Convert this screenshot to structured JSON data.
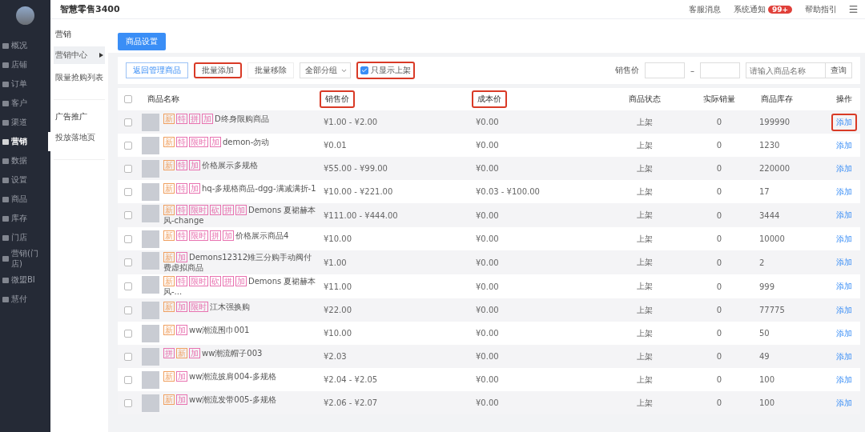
{
  "app": {
    "title": "智慧零售3400"
  },
  "topbar": {
    "links": [
      {
        "label": "客服消息"
      },
      {
        "label": "系统通知",
        "badge": "99+"
      },
      {
        "label": "帮助指引"
      }
    ]
  },
  "sidebar": {
    "items": [
      {
        "label": "概况",
        "selected": false
      },
      {
        "label": "店铺",
        "selected": false
      },
      {
        "label": "订单",
        "selected": false
      },
      {
        "label": "客户",
        "selected": false
      },
      {
        "label": "渠道",
        "selected": false
      },
      {
        "label": "营销",
        "selected": true
      },
      {
        "label": "数据",
        "selected": false
      },
      {
        "label": "设置",
        "selected": false
      },
      {
        "label": "商品",
        "selected": false
      },
      {
        "label": "库存",
        "selected": false
      },
      {
        "label": "门店",
        "selected": false
      },
      {
        "label": "营销(门店)",
        "selected": false
      },
      {
        "label": "微盟BI",
        "selected": false
      },
      {
        "label": "慧付",
        "selected": false
      }
    ]
  },
  "subnav": {
    "sections": [
      {
        "title": "营销",
        "items": [
          {
            "label": "营销中心",
            "selected": true
          },
          {
            "label": "限量抢购列表",
            "selected": false
          }
        ]
      },
      {
        "title": "广告推广",
        "items": [
          {
            "label": "投放落地页",
            "selected": false
          }
        ]
      }
    ]
  },
  "primary_button": "商品设置",
  "toolbar": {
    "buttons": [
      {
        "label": "返回管理商品",
        "kind": "outline",
        "highlighted": false
      },
      {
        "label": "批量添加",
        "kind": "plain",
        "highlighted": true
      },
      {
        "label": "批量移除",
        "kind": "plain",
        "highlighted": false
      }
    ],
    "group_select": "全部分组",
    "only_listed": {
      "label": "只显示上架",
      "checked": true,
      "highlighted": true
    },
    "price_label": "销售价",
    "price_separator": "–",
    "search": {
      "placeholder": "请输入商品名称"
    },
    "search_button": "查询"
  },
  "table": {
    "select_all_checked": false,
    "columns": [
      {
        "label": "商品名称",
        "highlighted": false
      },
      {
        "label": "销售价",
        "highlighted": true
      },
      {
        "label": "成本价",
        "highlighted": true
      },
      {
        "label": "商品状态",
        "highlighted": false
      },
      {
        "label": "实际销量",
        "highlighted": false
      },
      {
        "label": "商品库存",
        "highlighted": false
      },
      {
        "label": "操作",
        "highlighted": false
      }
    ],
    "rows": [
      {
        "tags": [
          {
            "text": "新",
            "color": "#f0a060"
          },
          {
            "text": "特",
            "color": "#e872b0"
          },
          {
            "text": "拼",
            "color": "#e872b0"
          },
          {
            "text": "加",
            "color": "#e872b0"
          }
        ],
        "name": "D终身限购商品",
        "price": "¥1.00 - ¥2.00",
        "cost": "¥0.00",
        "status": "上架",
        "sales": "0",
        "stock": "199990",
        "action": "添加",
        "action_highlighted": true,
        "checked": false
      },
      {
        "tags": [
          {
            "text": "新",
            "color": "#f0a060"
          },
          {
            "text": "特",
            "color": "#e872b0"
          },
          {
            "text": "限时",
            "color": "#e872b0"
          },
          {
            "text": "加",
            "color": "#e872b0"
          }
        ],
        "name": "demon-勿动",
        "price": "¥0.01",
        "cost": "¥0.00",
        "status": "上架",
        "sales": "0",
        "stock": "1230",
        "action": "添加",
        "action_highlighted": false,
        "checked": false
      },
      {
        "tags": [
          {
            "text": "新",
            "color": "#f0a060"
          },
          {
            "text": "特",
            "color": "#e872b0"
          },
          {
            "text": "加",
            "color": "#e872b0"
          }
        ],
        "name": "价格展示多规格",
        "price": "¥55.00 - ¥99.00",
        "cost": "¥0.00",
        "status": "上架",
        "sales": "0",
        "stock": "220000",
        "action": "添加",
        "action_highlighted": false,
        "checked": false
      },
      {
        "tags": [
          {
            "text": "新",
            "color": "#f0a060"
          },
          {
            "text": "特",
            "color": "#e872b0"
          },
          {
            "text": "加",
            "color": "#e872b0"
          }
        ],
        "name": "hq-多规格商品-dgg-满减满折-1",
        "price": "¥10.00 - ¥221.00",
        "cost": "¥0.03 - ¥100.00",
        "status": "上架",
        "sales": "0",
        "stock": "17",
        "action": "添加",
        "action_highlighted": false,
        "checked": false
      },
      {
        "tags": [
          {
            "text": "新",
            "color": "#f0a060"
          },
          {
            "text": "特",
            "color": "#e872b0"
          },
          {
            "text": "限时",
            "color": "#e872b0"
          },
          {
            "text": "砍",
            "color": "#e872b0"
          },
          {
            "text": "拼",
            "color": "#e872b0"
          },
          {
            "text": "加",
            "color": "#e872b0"
          }
        ],
        "name": "Demons 夏裙赫本风-change",
        "price": "¥111.00 - ¥444.00",
        "cost": "¥0.00",
        "status": "上架",
        "sales": "0",
        "stock": "3444",
        "action": "添加",
        "action_highlighted": false,
        "checked": false
      },
      {
        "tags": [
          {
            "text": "新",
            "color": "#f0a060"
          },
          {
            "text": "特",
            "color": "#e872b0"
          },
          {
            "text": "限时",
            "color": "#e872b0"
          },
          {
            "text": "拼",
            "color": "#e872b0"
          },
          {
            "text": "加",
            "color": "#e872b0"
          }
        ],
        "name": "价格展示商品4",
        "price": "¥10.00",
        "cost": "¥0.00",
        "status": "上架",
        "sales": "0",
        "stock": "10000",
        "action": "添加",
        "action_highlighted": false,
        "checked": false
      },
      {
        "tags": [
          {
            "text": "新",
            "color": "#f0a060"
          },
          {
            "text": "加",
            "color": "#e872b0"
          }
        ],
        "name": "Demons12312雉三分购手动阀付费虚拟商品",
        "price": "¥1.00",
        "cost": "¥0.00",
        "status": "上架",
        "sales": "0",
        "stock": "2",
        "action": "添加",
        "action_highlighted": false,
        "checked": false
      },
      {
        "tags": [
          {
            "text": "新",
            "color": "#f0a060"
          },
          {
            "text": "特",
            "color": "#e872b0"
          },
          {
            "text": "限时",
            "color": "#e872b0"
          },
          {
            "text": "砍",
            "color": "#e872b0"
          },
          {
            "text": "拼",
            "color": "#e872b0"
          },
          {
            "text": "加",
            "color": "#e872b0"
          }
        ],
        "name": "Demons 夏裙赫本风-...",
        "price": "¥11.00",
        "cost": "¥0.00",
        "status": "上架",
        "sales": "0",
        "stock": "999",
        "action": "添加",
        "action_highlighted": false,
        "checked": false
      },
      {
        "tags": [
          {
            "text": "新",
            "color": "#f0a060"
          },
          {
            "text": "加",
            "color": "#e872b0"
          },
          {
            "text": "限时",
            "color": "#e872b0"
          }
        ],
        "name": "江木强换购",
        "price": "¥22.00",
        "cost": "¥0.00",
        "status": "上架",
        "sales": "0",
        "stock": "77775",
        "action": "添加",
        "action_highlighted": false,
        "checked": false
      },
      {
        "tags": [
          {
            "text": "新",
            "color": "#f0a060"
          },
          {
            "text": "加",
            "color": "#e872b0"
          }
        ],
        "name": "ww潮流围巾001",
        "price": "¥10.00",
        "cost": "¥0.00",
        "status": "上架",
        "sales": "0",
        "stock": "50",
        "action": "添加",
        "action_highlighted": false,
        "checked": false
      },
      {
        "tags": [
          {
            "text": "拼",
            "color": "#e872b0"
          },
          {
            "text": "新",
            "color": "#f0a060"
          },
          {
            "text": "加",
            "color": "#e872b0"
          }
        ],
        "name": "ww潮流帽子003",
        "price": "¥2.03",
        "cost": "¥0.00",
        "status": "上架",
        "sales": "0",
        "stock": "49",
        "action": "添加",
        "action_highlighted": false,
        "checked": false
      },
      {
        "tags": [
          {
            "text": "新",
            "color": "#f0a060"
          },
          {
            "text": "加",
            "color": "#e872b0"
          }
        ],
        "name": "ww潮流披肩004-多规格",
        "price": "¥2.04 - ¥2.05",
        "cost": "¥0.00",
        "status": "上架",
        "sales": "0",
        "stock": "100",
        "action": "添加",
        "action_highlighted": false,
        "checked": false
      },
      {
        "tags": [
          {
            "text": "新",
            "color": "#f0a060"
          },
          {
            "text": "加",
            "color": "#e872b0"
          }
        ],
        "name": "ww潮流发带005-多规格",
        "price": "¥2.06 - ¥2.07",
        "cost": "¥0.00",
        "status": "上架",
        "sales": "0",
        "stock": "100",
        "action": "添加",
        "action_highlighted": false,
        "checked": false
      }
    ]
  }
}
